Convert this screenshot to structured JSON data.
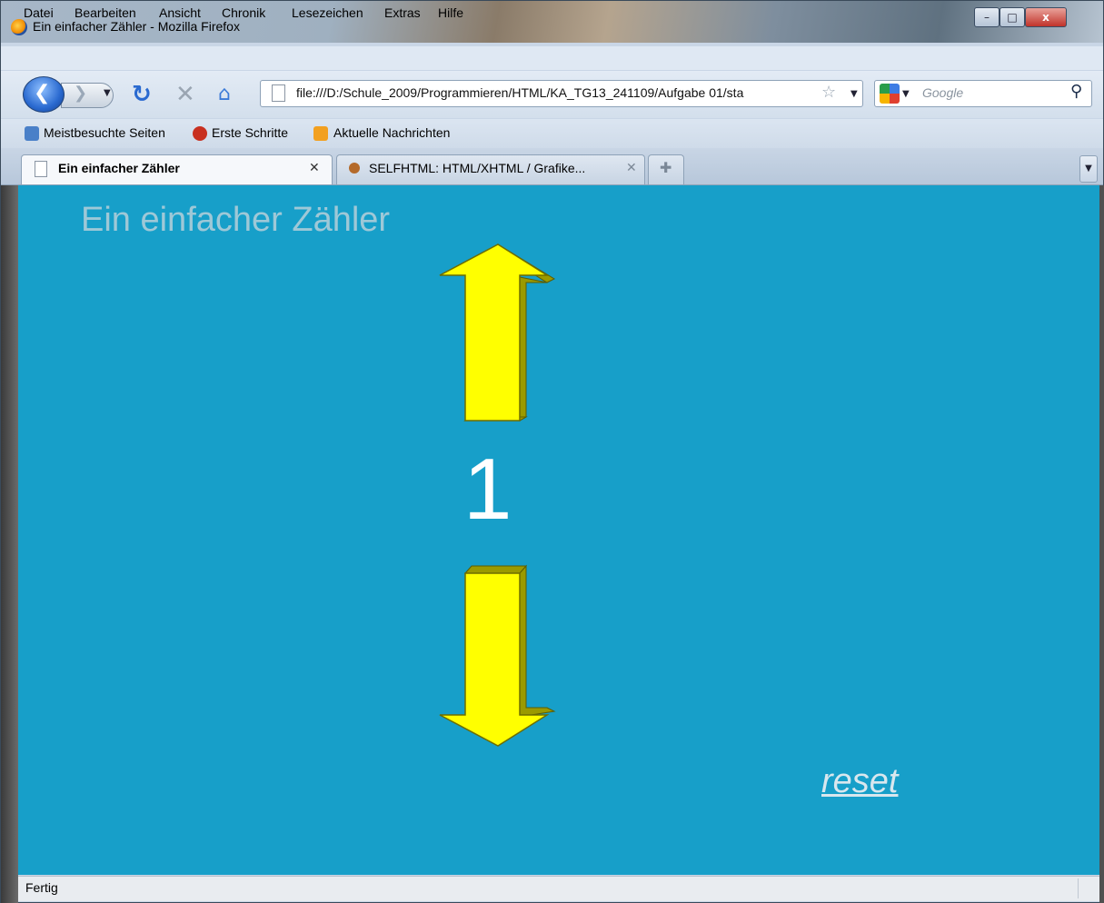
{
  "window": {
    "title": "Ein einfacher Zähler - Mozilla Firefox",
    "min_label": "–",
    "max_label": "□",
    "close_label": "x"
  },
  "menu": {
    "items": [
      "Datei",
      "Bearbeiten",
      "Ansicht",
      "Chronik",
      "Lesezeichen",
      "Extras",
      "Hilfe"
    ]
  },
  "navigation": {
    "url": "file:///D:/Schule_2009/Programmieren/HTML/KA_TG13_241109/Aufgabe 01/sta",
    "search_placeholder": "Google",
    "icons": {
      "back": "back-arrow-icon",
      "forward": "forward-arrow-icon",
      "reload": "reload-icon",
      "stop": "stop-icon",
      "home": "home-icon",
      "bookmark_star": "star-icon",
      "search": "magnifier-icon"
    }
  },
  "bookmarks": {
    "items": [
      "Meistbesuchte Seiten",
      "Erste Schritte",
      "Aktuelle Nachrichten"
    ]
  },
  "tabs": [
    {
      "label": "Ein einfacher Zähler",
      "active": true
    },
    {
      "label": "SELFHTML: HTML/XHTML / Grafike...",
      "active": false
    }
  ],
  "page": {
    "title": "Ein einfacher Zähler",
    "counter": "1",
    "reset_label": "reset",
    "background": "#179fc9",
    "arrow_color": "#ffff00"
  },
  "status": {
    "text": "Fertig"
  }
}
